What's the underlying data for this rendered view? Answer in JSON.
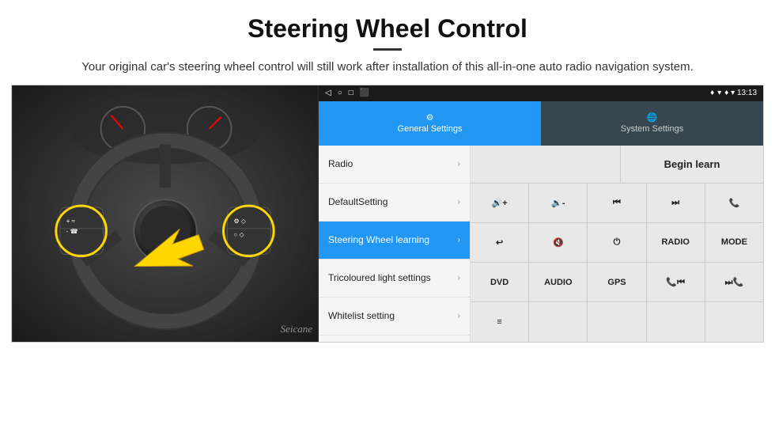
{
  "header": {
    "title": "Steering Wheel Control",
    "description": "Your original car's steering wheel control will still work after installation of this all-in-one auto radio navigation system."
  },
  "status_bar": {
    "left_icons": [
      "◁",
      "○",
      "□",
      "⬛"
    ],
    "right_icons": "♦ ▾ 13:13"
  },
  "tabs": {
    "general": {
      "label": "General Settings",
      "icon": "⚙"
    },
    "system": {
      "label": "System Settings",
      "icon": "🌐"
    }
  },
  "menu_items": [
    {
      "label": "Radio",
      "active": false
    },
    {
      "label": "DefaultSetting",
      "active": false
    },
    {
      "label": "Steering Wheel learning",
      "active": true
    },
    {
      "label": "Tricoloured light settings",
      "active": false
    },
    {
      "label": "Whitelist setting",
      "active": false
    }
  ],
  "begin_learn_label": "Begin learn",
  "button_rows": [
    [
      {
        "label": "🔊+",
        "type": "icon"
      },
      {
        "label": "🔉-",
        "type": "icon"
      },
      {
        "label": "⏮",
        "type": "icon"
      },
      {
        "label": "⏭",
        "type": "icon"
      },
      {
        "label": "📞",
        "type": "icon"
      }
    ],
    [
      {
        "label": "↩",
        "type": "icon"
      },
      {
        "label": "🔇",
        "type": "icon"
      },
      {
        "label": "⏻",
        "type": "icon"
      },
      {
        "label": "RADIO",
        "type": "text"
      },
      {
        "label": "MODE",
        "type": "text"
      }
    ],
    [
      {
        "label": "DVD",
        "type": "text"
      },
      {
        "label": "AUDIO",
        "type": "text"
      },
      {
        "label": "GPS",
        "type": "text"
      },
      {
        "label": "📞⏮",
        "type": "icon"
      },
      {
        "label": "⏭📞",
        "type": "icon"
      }
    ],
    [
      {
        "label": "≡",
        "type": "icon"
      },
      {
        "label": "",
        "type": "empty"
      },
      {
        "label": "",
        "type": "empty"
      },
      {
        "label": "",
        "type": "empty"
      },
      {
        "label": "",
        "type": "empty"
      }
    ]
  ],
  "watermark": "Seicane"
}
